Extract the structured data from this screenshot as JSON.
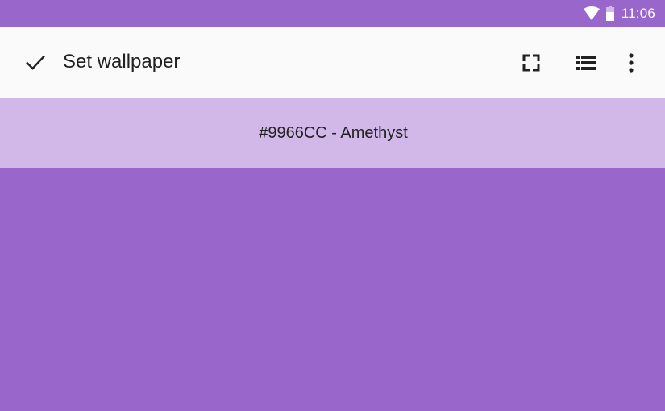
{
  "status_bar": {
    "time": "11:06",
    "icons": [
      "wifi-icon",
      "battery-icon"
    ]
  },
  "toolbar": {
    "confirm_icon": "check-icon",
    "title": "Set wallpaper",
    "actions": [
      "fullscreen-icon",
      "list-icon",
      "more-vert-icon"
    ]
  },
  "color_info": {
    "label": "#9966CC - Amethyst"
  },
  "colors": {
    "wallpaper": "#9966CC",
    "subheader": "#D1B8E8",
    "toolbar": "#fafafa"
  }
}
